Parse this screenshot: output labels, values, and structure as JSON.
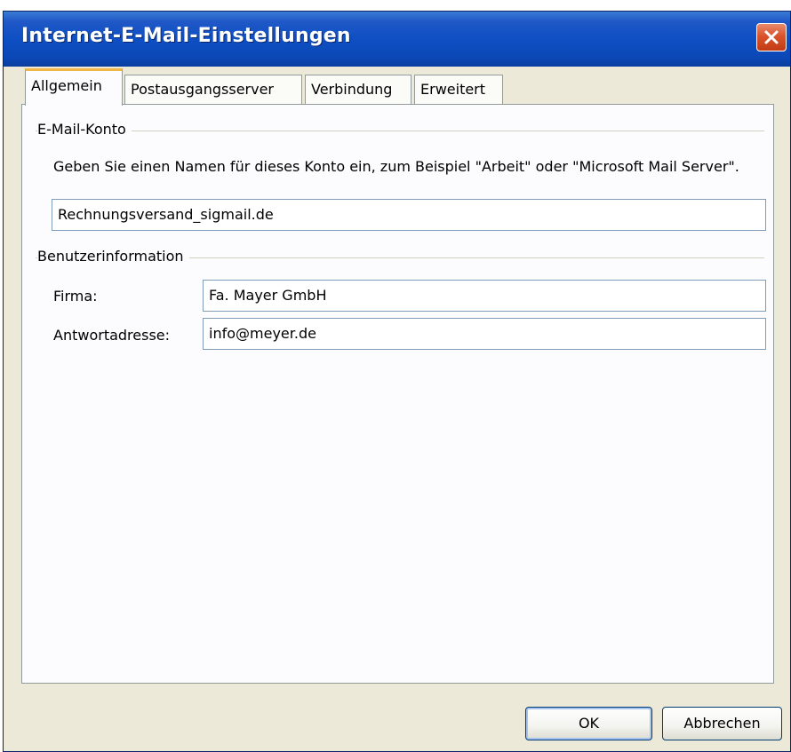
{
  "window": {
    "title": "Internet-E-Mail-Einstellungen",
    "close_icon": "close-icon",
    "colors": {
      "titlebar": "#0b47b5",
      "dialog_bg": "#ece9d8",
      "active_tab_accent": "#f0b646",
      "close_button": "#d9542c"
    }
  },
  "tabs": [
    {
      "label": "Allgemein",
      "active": true
    },
    {
      "label": "Postausgangsserver",
      "active": false
    },
    {
      "label": "Verbindung",
      "active": false
    },
    {
      "label": "Erweitert",
      "active": false
    }
  ],
  "email_account": {
    "group_title": "E-Mail-Konto",
    "description": "Geben Sie einen Namen für dieses Konto ein, zum Beispiel \"Arbeit\" oder \"Microsoft Mail Server\".",
    "account_name_value": "Rechnungsversand_sigmail.de"
  },
  "user_info": {
    "group_title": "Benutzerinformation",
    "company_label": "Firma:",
    "company_value": "Fa. Mayer GmbH",
    "reply_label": "Antwortadresse:",
    "reply_value": "info@meyer.de"
  },
  "buttons": {
    "ok_label": "OK",
    "cancel_label": "Abbrechen"
  }
}
